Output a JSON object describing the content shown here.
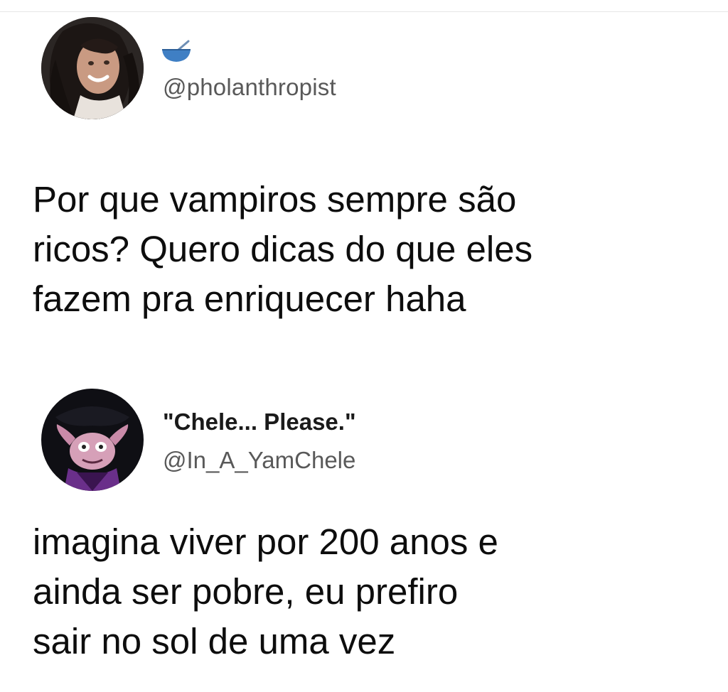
{
  "tweets": [
    {
      "display_name_icon": "bowl-with-spoon-emoji",
      "handle": "@pholanthropist",
      "text_lines": [
        "Por que vampiros sempre são",
        "ricos? Quero dicas do que eles",
        "fazem pra enriquecer haha"
      ]
    },
    {
      "display_name": "\"Chele... Please.\"",
      "handle": "@In_A_YamChele",
      "text_lines": [
        "imagina viver por 200 anos e",
        "ainda ser pobre, eu prefiro",
        "sair no sol de uma vez"
      ]
    }
  ],
  "colors": {
    "background": "#ffffff",
    "text": "#0d0d0d",
    "handle": "#595959",
    "emoji_blue": "#3f7fc4"
  }
}
